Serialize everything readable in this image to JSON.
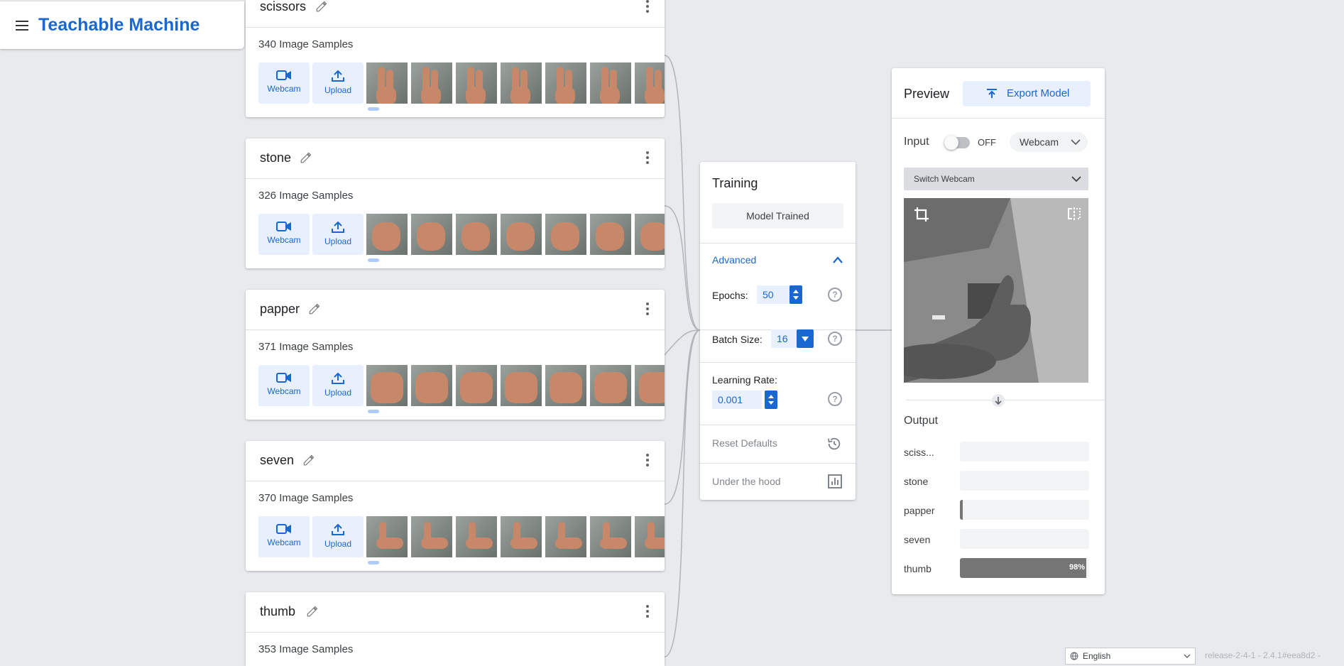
{
  "app": {
    "title": "Teachable Machine"
  },
  "classes": [
    {
      "name": "scissors",
      "samples": "340 Image Samples"
    },
    {
      "name": "stone",
      "samples": "326 Image Samples"
    },
    {
      "name": "papper",
      "samples": "371 Image Samples"
    },
    {
      "name": "seven",
      "samples": "370 Image Samples"
    },
    {
      "name": "thumb",
      "samples": "353 Image Samples"
    }
  ],
  "add_buttons": {
    "webcam": "Webcam",
    "upload": "Upload"
  },
  "training": {
    "title": "Training",
    "status_button": "Model Trained",
    "advanced_label": "Advanced",
    "epochs_label": "Epochs:",
    "epochs_value": "50",
    "batch_label": "Batch Size:",
    "batch_value": "16",
    "lr_label": "Learning Rate:",
    "lr_value": "0.001",
    "reset_label": "Reset Defaults",
    "hood_label": "Under the hood"
  },
  "preview": {
    "title": "Preview",
    "export_label": "Export Model",
    "input_label": "Input",
    "toggle_state": "OFF",
    "input_source": "Webcam",
    "switch_webcam": "Switch Webcam",
    "output_label": "Output",
    "outputs": [
      {
        "label": "sciss...",
        "value": 0.0,
        "text": ""
      },
      {
        "label": "stone",
        "value": 0.0,
        "text": ""
      },
      {
        "label": "papper",
        "value": 0.02,
        "text": ""
      },
      {
        "label": "seven",
        "value": 0.0,
        "text": ""
      },
      {
        "label": "thumb",
        "value": 0.98,
        "text": "98%"
      }
    ]
  },
  "footer": {
    "language": "English",
    "release": "release-2-4-1 - 2.4.1#eea8d2 -"
  },
  "colors": {
    "accent": "#1967d2",
    "accent_light": "#e8f0fe",
    "bar": "#757575"
  }
}
